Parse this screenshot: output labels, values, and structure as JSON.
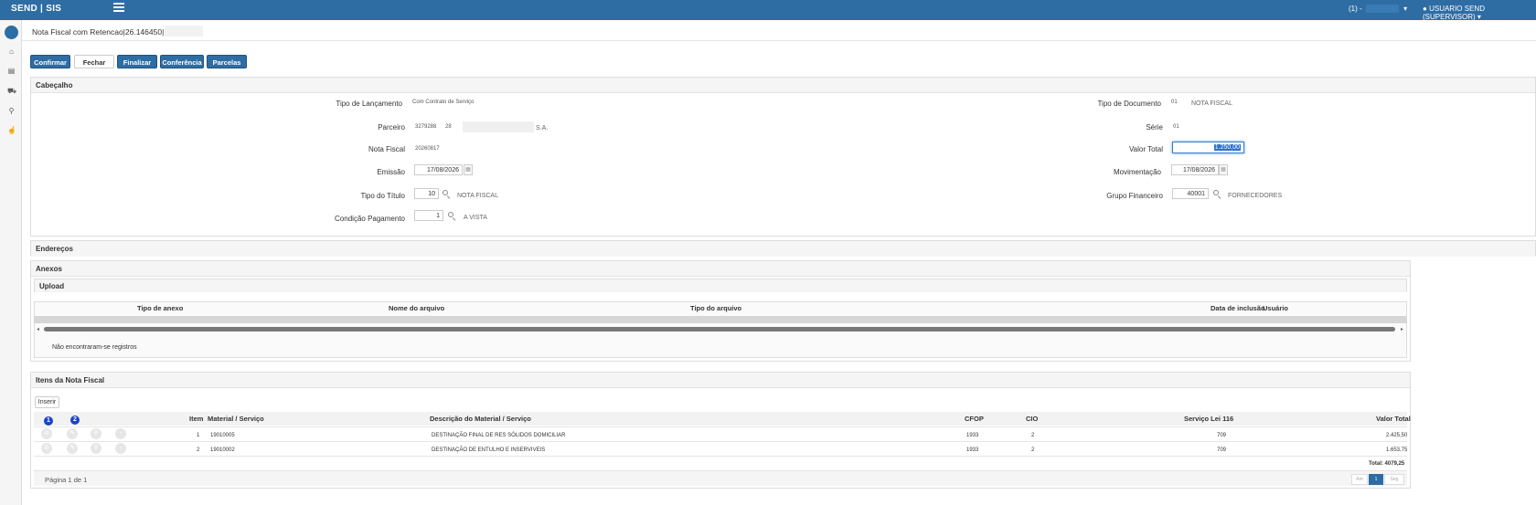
{
  "topbar": {
    "brand": "SEND | SIS",
    "company": "(1) -",
    "user": "USUARIO SEND (SUPERVISOR)"
  },
  "page": {
    "title": "Nota Fiscal com Retencao|26.146450|"
  },
  "toolbar": {
    "confirmar": "Confirmar",
    "fechar": "Fechar",
    "finalizar": "Finalizar",
    "conferencia": "Conferência",
    "parcelas": "Parcelas"
  },
  "cabecalho": {
    "title": "Cabeçalho",
    "tipo_lancamento": {
      "label": "Tipo de Lançamento",
      "value": "Com Contrato de Serviço"
    },
    "tipo_documento": {
      "label": "Tipo de Documento",
      "code": "01",
      "value": "NOTA FISCAL"
    },
    "parceiro": {
      "label": "Parceiro",
      "code": "3279288",
      "sub": "28",
      "suffix": "S.A."
    },
    "serie": {
      "label": "Série",
      "value": "01"
    },
    "nota_fiscal": {
      "label": "Nota Fiscal",
      "value": "20260817"
    },
    "valor_total": {
      "label": "Valor Total",
      "value": "1.250,00"
    },
    "emissao": {
      "label": "Emissão",
      "value": "17/08/2026"
    },
    "movimentacao": {
      "label": "Movimentação",
      "value": "17/08/2026"
    },
    "tipo_titulo": {
      "label": "Tipo do Título",
      "value": "10",
      "desc": "NOTA FISCAL"
    },
    "grupo_financeiro": {
      "label": "Grupo Financeiro",
      "value": "40001",
      "desc": "FORNECEDORES"
    },
    "condicao_pagamento": {
      "label": "Condição Pagamento",
      "value": "1",
      "desc": "A VISTA"
    }
  },
  "enderecos": {
    "title": "Endereços"
  },
  "anexos": {
    "title": "Anexos",
    "upload": "Upload",
    "columns": [
      "Tipo de anexo",
      "Nome do arquivo",
      "Tipo do arquivo",
      "Data de inclusão",
      "Usuário"
    ],
    "empty": "Não encontraram-se registros"
  },
  "itens": {
    "title": "Itens da Nota Fiscal",
    "inserir": "Inserir",
    "badges": [
      "1",
      "2"
    ],
    "columns": {
      "item": "Item",
      "material": "Material / Serviço",
      "descricao": "Descrição do Material / Serviço",
      "cfop": "CFOP",
      "cio": "CIO",
      "servico": "Serviço Lei 116",
      "valor": "Valor Total"
    },
    "rows": [
      {
        "item": "1",
        "material": "19010005",
        "descricao": "DESTINAÇÃO FINAL DE RES SÓLIDOS DOMICILIAR",
        "cfop": "1933",
        "cio": "2",
        "servico": "709",
        "valor": "2.425,50"
      },
      {
        "item": "2",
        "material": "19010002",
        "descricao": "DESTINAÇÃO DE ENTULHO E INSERVIVEIS",
        "cfop": "1933",
        "cio": "2",
        "servico": "709",
        "valor": "1.653,75"
      }
    ],
    "total": "Total: 4079,25",
    "pagina": "Página 1 de 1",
    "pager": {
      "prev": "Ant",
      "current": "1",
      "next": "Seg"
    }
  }
}
